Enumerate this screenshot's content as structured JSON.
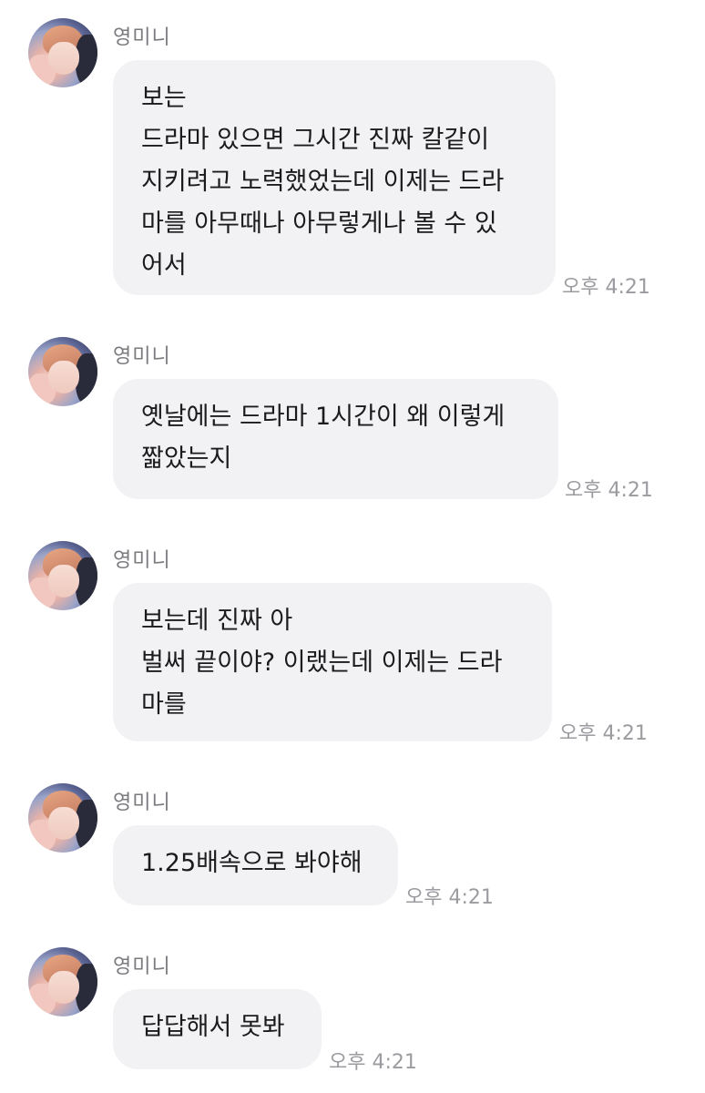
{
  "messages": [
    {
      "sender": "영미니",
      "text": "보는\n드라마 있으면 그시간 진짜 칼같이\n지키려고 노력했었는데 이제는 드라\n마를 아무때나 아무렇게나 볼 수 있\n어서",
      "time": "오후 4:21"
    },
    {
      "sender": "영미니",
      "text": "옛날에는 드라마 1시간이 왜 이렇게\n짧았는지",
      "time": "오후 4:21"
    },
    {
      "sender": "영미니",
      "text": "보는데 진짜 아\n벌써 끝이야? 이랬는데 이제는 드라\n마를",
      "time": "오후 4:21"
    },
    {
      "sender": "영미니",
      "text": "1.25배속으로 봐야해",
      "time": "오후 4:21"
    },
    {
      "sender": "영미니",
      "text": "답답해서 못봐",
      "time": "오후 4:21"
    }
  ]
}
